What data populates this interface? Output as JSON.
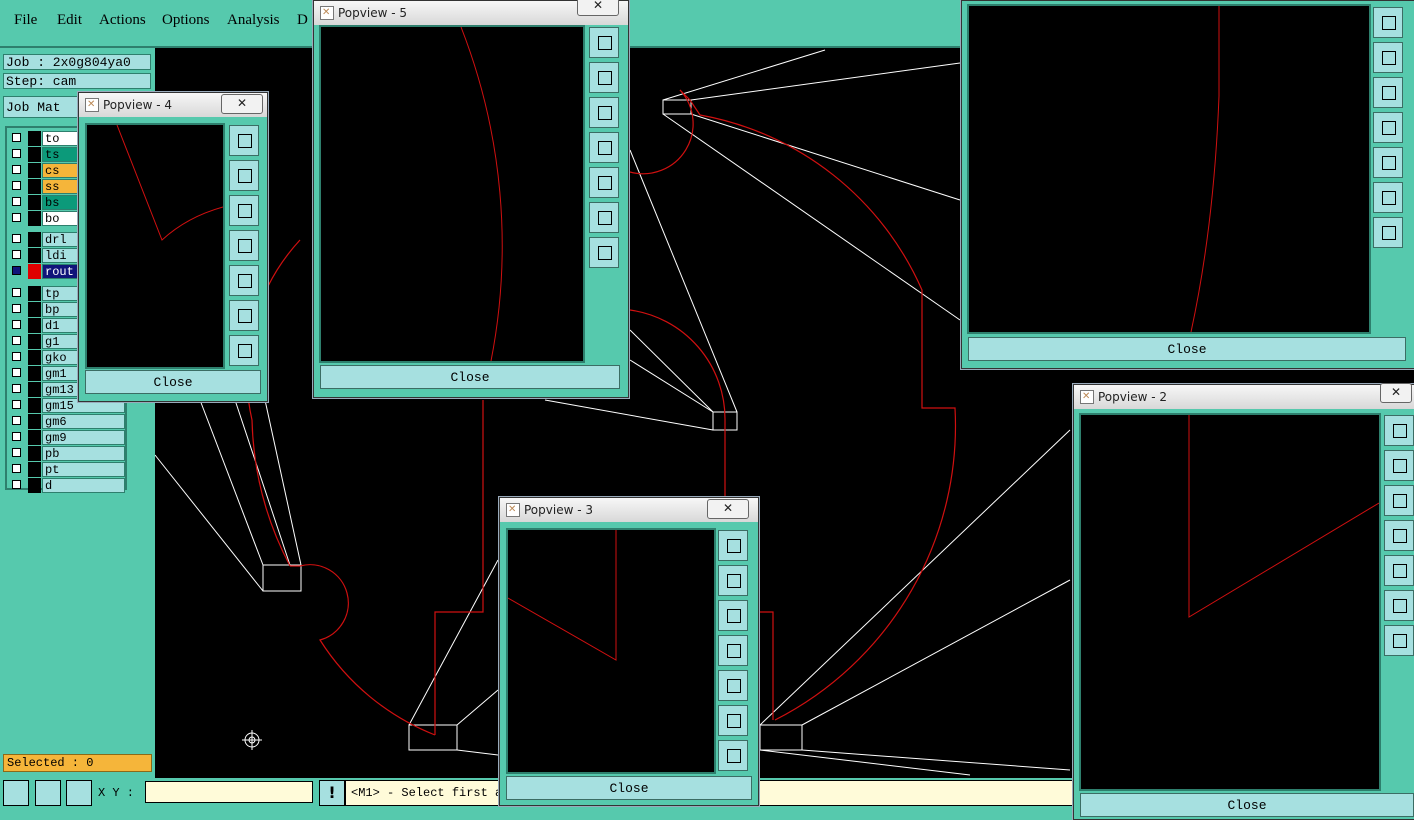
{
  "menu": {
    "items": [
      "File",
      "Edit",
      "Actions",
      "Options",
      "Analysis",
      "D"
    ]
  },
  "left_panel": {
    "job": "Job : 2x0g804ya0",
    "step": "Step: cam",
    "matrix_label": "Job Mat",
    "layers": [
      {
        "name": "to",
        "color": "#ffffff"
      },
      {
        "name": "ts",
        "color": "#0c9a7a"
      },
      {
        "name": "cs",
        "color": "#f5b53a"
      },
      {
        "name": "ss",
        "color": "#f5b53a"
      },
      {
        "name": "bs",
        "color": "#0c9a7a"
      },
      {
        "name": "bo",
        "color": "#ffffff"
      },
      {
        "name": "drl",
        "color": "#a6e0e0"
      },
      {
        "name": "ldi",
        "color": "#a6e0e0"
      },
      {
        "name": "rout",
        "color": "#10147a"
      },
      {
        "name": "tp",
        "color": "#a6e0e0"
      },
      {
        "name": "bp",
        "color": "#a6e0e0"
      },
      {
        "name": "d1",
        "color": "#a6e0e0"
      },
      {
        "name": "g1",
        "color": "#a6e0e0"
      },
      {
        "name": "gko",
        "color": "#a6e0e0"
      },
      {
        "name": "gm1",
        "color": "#a6e0e0"
      },
      {
        "name": "gm13",
        "color": "#a6e0e0"
      },
      {
        "name": "gm15",
        "color": "#a6e0e0"
      },
      {
        "name": "gm6",
        "color": "#a6e0e0"
      },
      {
        "name": "gm9",
        "color": "#a6e0e0"
      },
      {
        "name": "pb",
        "color": "#a6e0e0"
      },
      {
        "name": "pt",
        "color": "#a6e0e0"
      },
      {
        "name": "d",
        "color": "#a6e0e0"
      }
    ],
    "selected": "Selected : 0"
  },
  "status": {
    "xy_label": "X Y :",
    "xy_value": "",
    "prompt": "<M1> - Select first a"
  },
  "popups": [
    {
      "title": "Popview - 5",
      "close_x": "✕",
      "close_label": "Close"
    },
    {
      "title": "Popview - 4",
      "close_x": "✕",
      "close_label": "Close"
    },
    {
      "title": "Popview - 3",
      "close_x": "✕",
      "close_label": "Close"
    },
    {
      "title": "Popview - 2",
      "close_x": "✕",
      "close_label": "Close"
    },
    {
      "title": "",
      "close_x": "",
      "close_label": "Close"
    }
  ],
  "toolbar_icons": [
    "zoom-home-icon",
    "pan-up-icon",
    "pan-down-icon",
    "pan-left-icon",
    "pan-right-icon",
    "zoom-fit-icon",
    "zoom-in-icon"
  ],
  "colors": {
    "panel": "#56c9ad",
    "canvas": "#000000",
    "trace": "#d01010",
    "line": "#ffffff"
  }
}
